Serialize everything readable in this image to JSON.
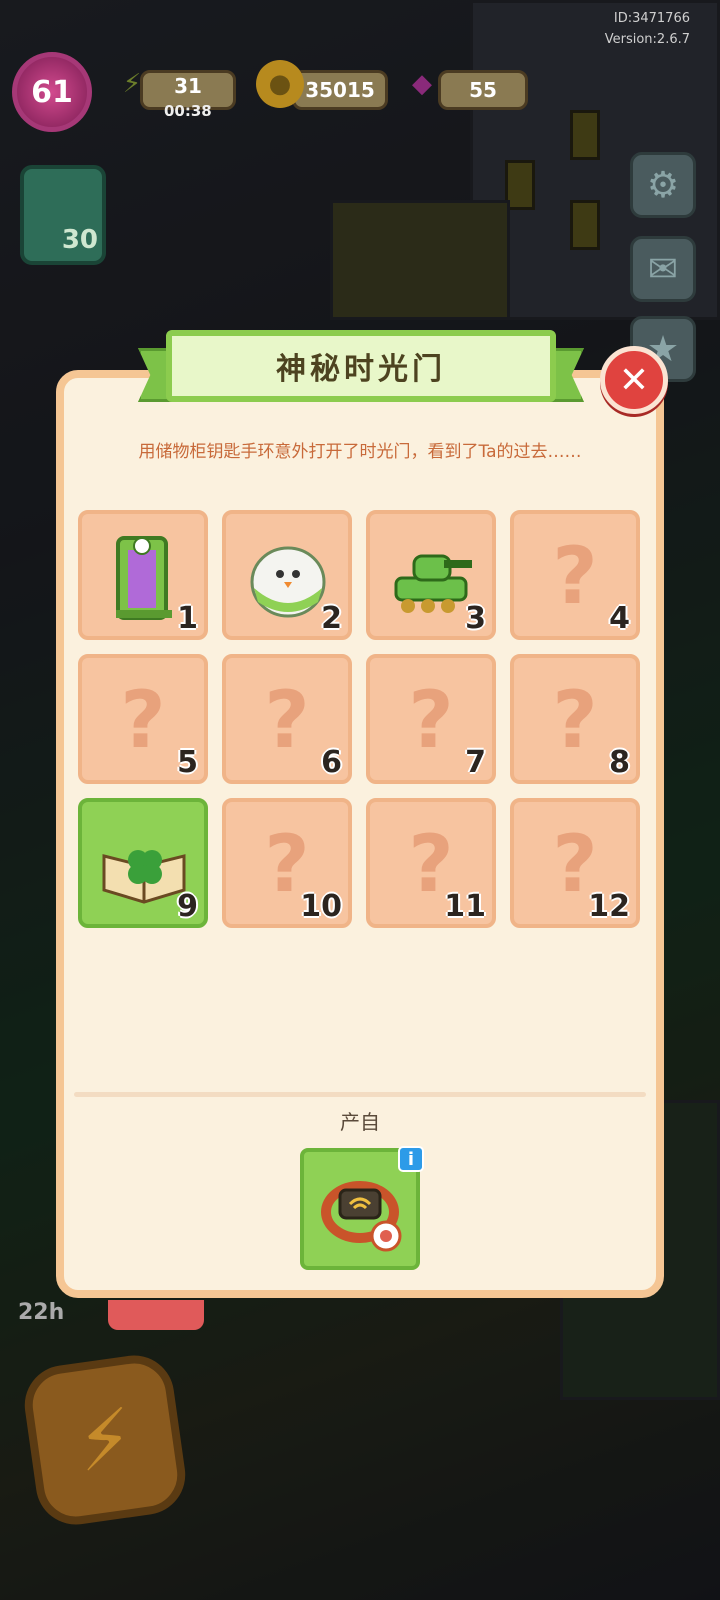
{
  "hud": {
    "id_text": "ID:3471766",
    "version_text": "Version:2.6.7",
    "level": "61",
    "energy": "31",
    "energy_timer": "00:38",
    "coins": "35015",
    "gems": "55",
    "left_card_count": "30",
    "boost_timer": "22h"
  },
  "panel": {
    "title": "神秘时光门",
    "description": "用储物柜钥匙手环意外打开了时光门，看到了Ta的过去……",
    "from_label": "产自"
  },
  "slots": [
    {
      "number": "1",
      "unlocked": true,
      "icon": "portal-door-icon",
      "color": "#f7c4a0"
    },
    {
      "number": "2",
      "unlocked": true,
      "icon": "hatching-egg-icon",
      "color": "#f7c4a0"
    },
    {
      "number": "3",
      "unlocked": true,
      "icon": "toy-tank-icon",
      "color": "#f7c4a0"
    },
    {
      "number": "4",
      "unlocked": false
    },
    {
      "number": "5",
      "unlocked": false
    },
    {
      "number": "6",
      "unlocked": false
    },
    {
      "number": "7",
      "unlocked": false
    },
    {
      "number": "8",
      "unlocked": false
    },
    {
      "number": "9",
      "unlocked": true,
      "icon": "clover-book-icon",
      "color": "#8fd155"
    },
    {
      "number": "10",
      "unlocked": false
    },
    {
      "number": "11",
      "unlocked": false
    },
    {
      "number": "12",
      "unlocked": false
    }
  ],
  "locked_glyph": "?",
  "source_item": {
    "icon": "key-bracelet-icon"
  },
  "colors": {
    "panel_bg": "#fbf1de",
    "ribbon_green": "#8ccc4e",
    "close_red": "#e0433f",
    "desc_text": "#c86a3a"
  }
}
